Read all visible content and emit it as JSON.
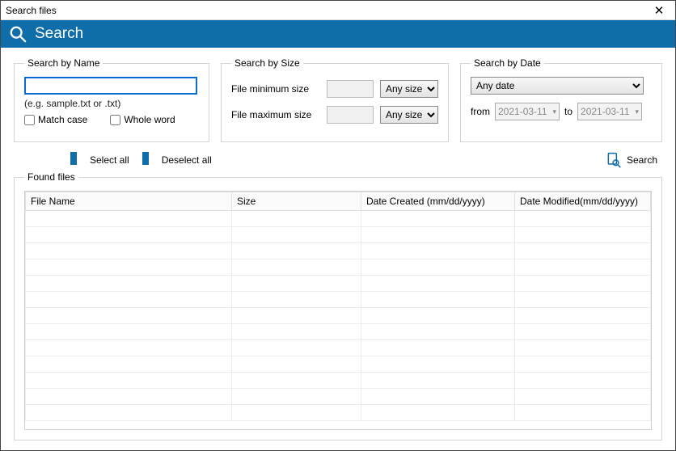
{
  "window": {
    "title": "Search files"
  },
  "banner": {
    "title": "Search"
  },
  "searchByName": {
    "legend": "Search by Name",
    "value": "",
    "hint": "(e.g. sample.txt or .txt)",
    "matchCase": "Match case",
    "wholeWord": "Whole word"
  },
  "searchBySize": {
    "legend": "Search by Size",
    "minLabel": "File minimum size",
    "maxLabel": "File maximum size",
    "unitMin": "Any size",
    "unitMax": "Any size"
  },
  "searchByDate": {
    "legend": "Search by Date",
    "anyDate": "Any date",
    "fromLabel": "from",
    "toLabel": "to",
    "fromValue": "2021-03-11",
    "toValue": "2021-03-11"
  },
  "toolbar": {
    "selectAll": "Select all",
    "deselectAll": "Deselect all",
    "search": "Search"
  },
  "foundFiles": {
    "legend": "Found files",
    "columns": {
      "fileName": "File Name",
      "size": "Size",
      "dateCreated": "Date Created (mm/dd/yyyy)",
      "dateModified": "Date Modified(mm/dd/yyyy)"
    }
  }
}
